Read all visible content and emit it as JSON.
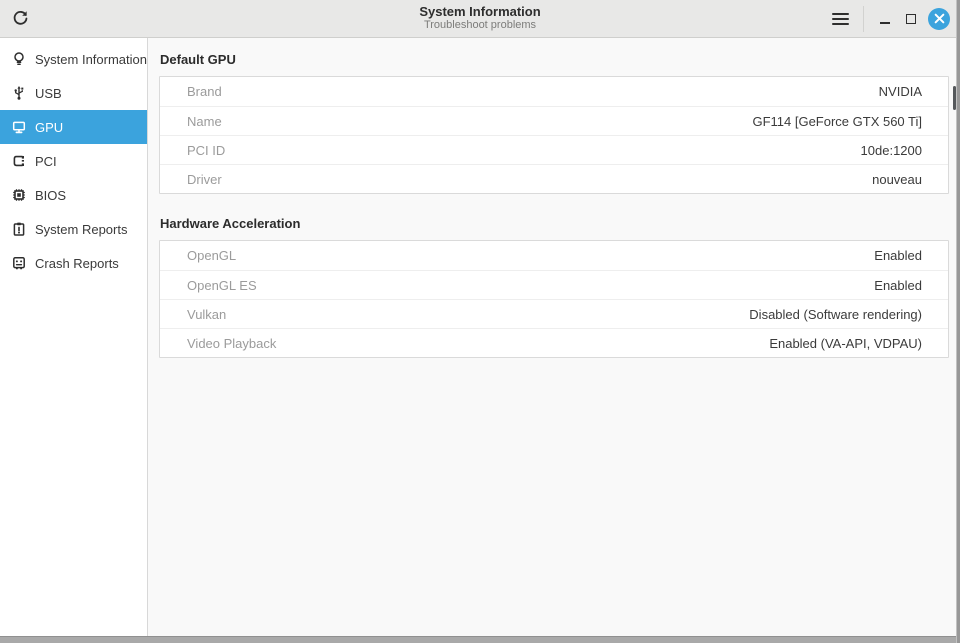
{
  "window": {
    "title": "System Information",
    "subtitle": "Troubleshoot problems",
    "controls": {
      "refresh_icon": "refresh-icon",
      "menu_icon": "hamburger-menu-icon",
      "minimize_icon": "minimize-icon",
      "maximize_icon": "maximize-icon",
      "close_icon": "close-icon"
    }
  },
  "colors": {
    "accent": "#3ba3dd",
    "close_button": "#35a3e2",
    "titlebar_bg": "#e8e8e7",
    "sidebar_bg": "#ffffff",
    "content_bg": "#f9f9f9",
    "card_border": "#dadada",
    "label_gray": "#9b9b9b",
    "value_dark": "#3b3b3b"
  },
  "sidebar": {
    "items": [
      {
        "label": "System Information",
        "icon": "lightbulb-icon",
        "selected": false
      },
      {
        "label": "USB",
        "icon": "usb-icon",
        "selected": false
      },
      {
        "label": "GPU",
        "icon": "monitor-icon",
        "selected": true
      },
      {
        "label": "PCI",
        "icon": "pci-card-icon",
        "selected": false
      },
      {
        "label": "BIOS",
        "icon": "chip-icon",
        "selected": false
      },
      {
        "label": "System Reports",
        "icon": "clipboard-alert-icon",
        "selected": false
      },
      {
        "label": "Crash Reports",
        "icon": "crash-screen-icon",
        "selected": false
      }
    ]
  },
  "sections": [
    {
      "title": "Default GPU",
      "rows": [
        {
          "label": "Brand",
          "value": "NVIDIA"
        },
        {
          "label": "Name",
          "value": "GF114 [GeForce GTX 560 Ti]"
        },
        {
          "label": "PCI ID",
          "value": "10de:1200"
        },
        {
          "label": "Driver",
          "value": "nouveau"
        }
      ]
    },
    {
      "title": "Hardware Acceleration",
      "rows": [
        {
          "label": "OpenGL",
          "value": "Enabled"
        },
        {
          "label": "OpenGL ES",
          "value": "Enabled"
        },
        {
          "label": "Vulkan",
          "value": "Disabled (Software rendering)"
        },
        {
          "label": "Video Playback",
          "value": "Enabled (VA-API, VDPAU)"
        }
      ]
    }
  ]
}
